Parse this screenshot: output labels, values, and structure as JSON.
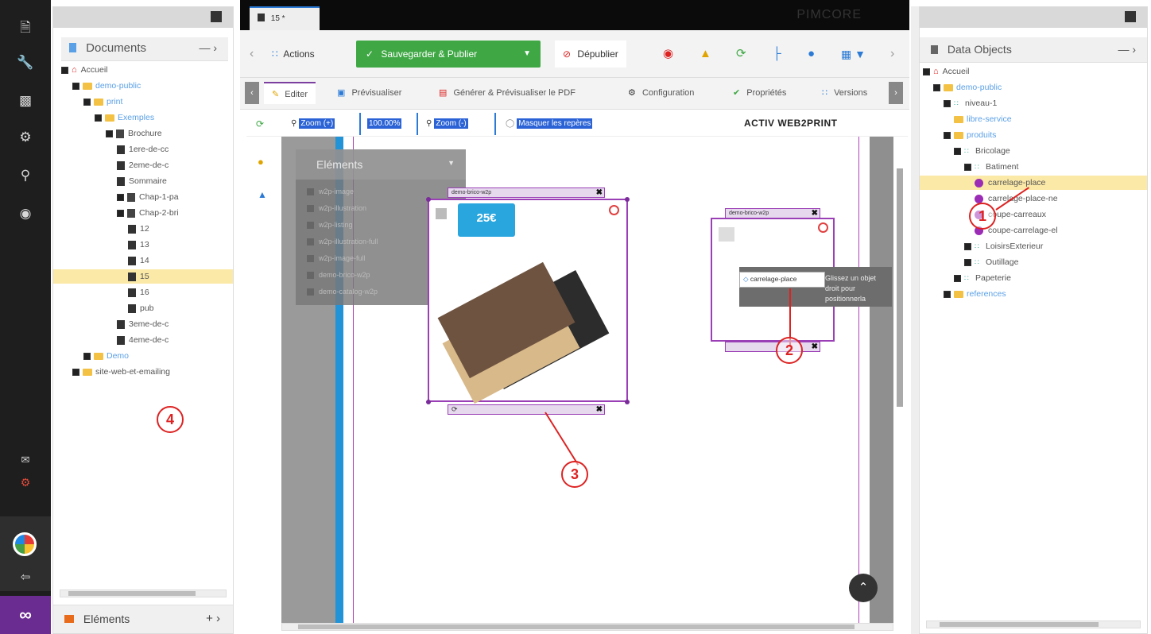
{
  "app": {
    "brand": "PIMCORE",
    "tab_title": "15 *"
  },
  "sidebar_icons": [
    "document-icon",
    "wrench-icon",
    "chart-icon",
    "gear-icon",
    "search-icon",
    "dashboard-icon"
  ],
  "documents_panel": {
    "title": "Documents",
    "footer_label": "Eléments",
    "tree": [
      {
        "label": "Accueil",
        "depth": 0,
        "kind": "home"
      },
      {
        "label": "demo-public",
        "depth": 1,
        "kind": "folder",
        "link": true
      },
      {
        "label": "print",
        "depth": 2,
        "kind": "folder",
        "link": true
      },
      {
        "label": "Exemples",
        "depth": 3,
        "kind": "folder",
        "link": true
      },
      {
        "label": "Brochure",
        "depth": 4,
        "kind": "book"
      },
      {
        "label": "1ere-de-cc",
        "depth": 5,
        "kind": "doc"
      },
      {
        "label": "2eme-de-c",
        "depth": 5,
        "kind": "doc"
      },
      {
        "label": "Sommaire",
        "depth": 5,
        "kind": "doc"
      },
      {
        "label": "Chap-1-pa",
        "depth": 5,
        "kind": "book"
      },
      {
        "label": "Chap-2-bri",
        "depth": 5,
        "kind": "book"
      },
      {
        "label": "12",
        "depth": 6,
        "kind": "doc"
      },
      {
        "label": "13",
        "depth": 6,
        "kind": "doc"
      },
      {
        "label": "14",
        "depth": 6,
        "kind": "doc"
      },
      {
        "label": "15",
        "depth": 6,
        "kind": "doc",
        "selected": true
      },
      {
        "label": "16",
        "depth": 6,
        "kind": "doc"
      },
      {
        "label": "pub",
        "depth": 6,
        "kind": "doc"
      },
      {
        "label": "3eme-de-c",
        "depth": 5,
        "kind": "doc"
      },
      {
        "label": "4eme-de-c",
        "depth": 5,
        "kind": "doc"
      },
      {
        "label": "Demo",
        "depth": 2,
        "kind": "folder",
        "link": true
      },
      {
        "label": "site-web-et-emailing",
        "depth": 1,
        "kind": "folder"
      }
    ]
  },
  "data_objects_panel": {
    "title": "Data Objects",
    "tree": [
      {
        "label": "Accueil",
        "depth": 0,
        "kind": "home"
      },
      {
        "label": "demo-public",
        "depth": 1,
        "kind": "folder",
        "link": true
      },
      {
        "label": "niveau-1",
        "depth": 2,
        "kind": "node"
      },
      {
        "label": "libre-service",
        "depth": 2,
        "kind": "folder",
        "link": true
      },
      {
        "label": "produits",
        "depth": 2,
        "kind": "folder",
        "link": true
      },
      {
        "label": "Bricolage",
        "depth": 3,
        "kind": "node"
      },
      {
        "label": "Batiment",
        "depth": 4,
        "kind": "node"
      },
      {
        "label": "carrelage-place",
        "depth": 5,
        "kind": "leaf",
        "selected": true
      },
      {
        "label": "carrelage-place-ne",
        "depth": 5,
        "kind": "leaf"
      },
      {
        "label": "coupe-carreaux",
        "depth": 5,
        "kind": "leaf"
      },
      {
        "label": "coupe-carrelage-el",
        "depth": 5,
        "kind": "leaf"
      },
      {
        "label": "LoisirsExterieur",
        "depth": 4,
        "kind": "node"
      },
      {
        "label": "Outillage",
        "depth": 4,
        "kind": "node"
      },
      {
        "label": "Papeterie",
        "depth": 3,
        "kind": "node"
      },
      {
        "label": "references",
        "depth": 2,
        "kind": "folder",
        "link": true
      }
    ]
  },
  "toolbar": {
    "actions": "Actions",
    "publish": "Sauvegarder & Publier",
    "unpublish": "Dépublier"
  },
  "subtabs": {
    "edit": "Editer",
    "preview": "Prévisualiser",
    "pdf": "Générer & Prévisualiser le PDF",
    "config": "Configuration",
    "props": "Propriétés",
    "versions": "Versions"
  },
  "zoom_bar": {
    "zoom_in": "Zoom (+)",
    "zoom_value": "100.00%",
    "zoom_out": "Zoom (-)",
    "hide_markers": "Masquer les repères",
    "logo": "ACTIV WEB2PRINT"
  },
  "elements_menu": {
    "title": "Eléments",
    "items": [
      "w2p-image",
      "w2p-illustration",
      "w2p-listing",
      "w2p-illustration-full",
      "w2p-image-full",
      "demo-brico-w2p",
      "demo-catalog-w2p"
    ]
  },
  "canvas": {
    "wrapper1_label": "demo-brico-w2p",
    "wrapper2_label": "demo-brico-w2p",
    "price_badge": "25€",
    "drop_item": "carrelage-place",
    "drop_hint": "Glissez un objet droit pour positionnerla"
  },
  "annotations": [
    "1",
    "2",
    "3",
    "4"
  ]
}
